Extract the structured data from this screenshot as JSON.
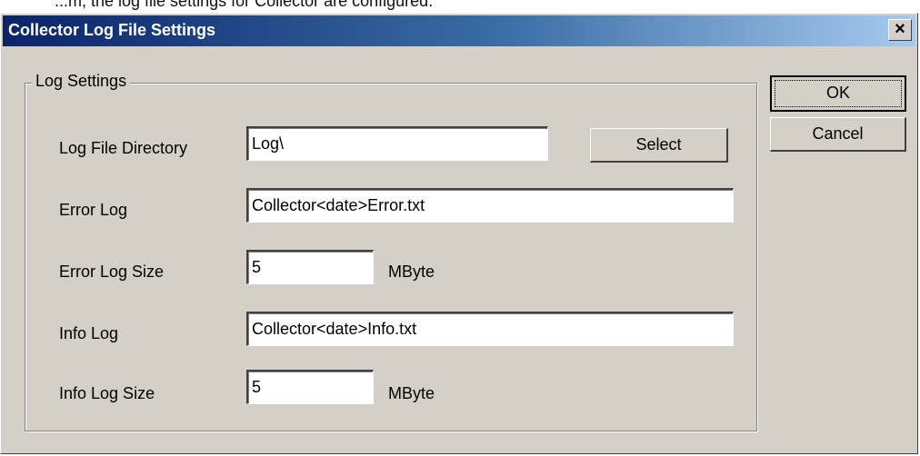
{
  "top_strip_text": "...m, the log file settings for Collector are configured.",
  "window": {
    "title": "Collector Log File Settings",
    "close_glyph": "×"
  },
  "group": {
    "legend": "Log Settings"
  },
  "fields": {
    "log_dir": {
      "label": "Log File Directory",
      "value": "Log\\"
    },
    "error_log": {
      "label": "Error Log",
      "value": "Collector<date>Error.txt"
    },
    "error_size": {
      "label": "Error Log Size",
      "value": "5",
      "unit": "MByte"
    },
    "info_log": {
      "label": "Info Log",
      "value": "Collector<date>Info.txt"
    },
    "info_size": {
      "label": "Info Log Size",
      "value": "5",
      "unit": "MByte"
    }
  },
  "buttons": {
    "select": "Select",
    "ok": "OK",
    "cancel": "Cancel"
  },
  "colors": {
    "title_start": "#0a246a",
    "title_end": "#a6caf0",
    "face": "#d4d0c8"
  }
}
